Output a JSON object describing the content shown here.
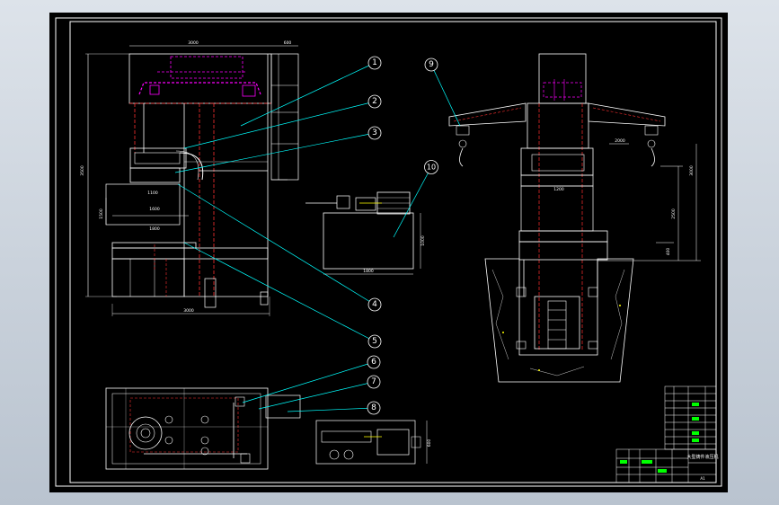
{
  "colors": {
    "background": "#c9d1dc",
    "sheet": "#000000",
    "frame": "#ffffff",
    "leader": "#00ffff",
    "magenta": "#ff00ff",
    "hidden_red": "#ff3030",
    "green": "#00ff00",
    "yellow": "#ffff00"
  },
  "balloons": {
    "b1": "1",
    "b2": "2",
    "b3": "3",
    "b4": "4",
    "b5": "5",
    "b6": "6",
    "b7": "7",
    "b8": "8",
    "b9": "9",
    "b10": "10"
  },
  "title_block": {
    "name": "大型铸件液压机",
    "label": "A1"
  }
}
